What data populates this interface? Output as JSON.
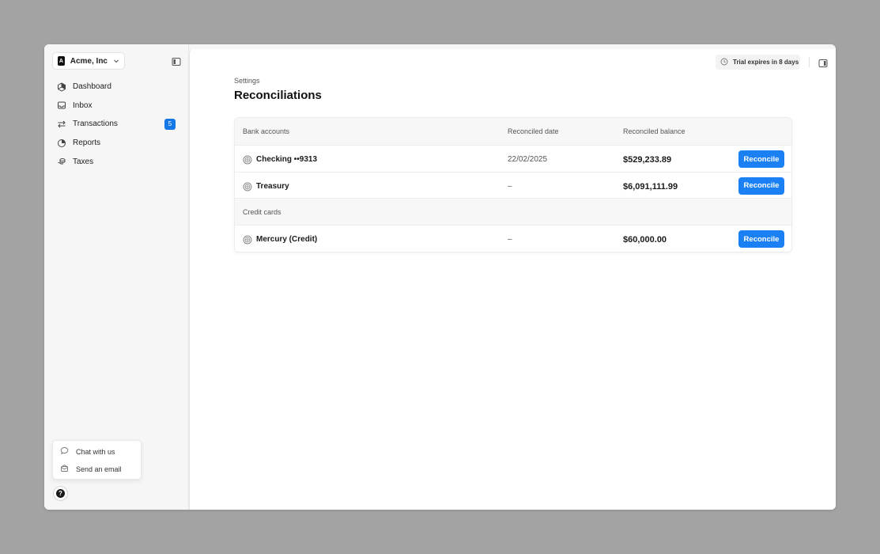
{
  "org": {
    "logo_letter": "A",
    "name": "Acme, Inc"
  },
  "sidebar": {
    "items": [
      {
        "label": "Dashboard",
        "icon": "dashboard-icon"
      },
      {
        "label": "Inbox",
        "icon": "inbox-icon"
      },
      {
        "label": "Transactions",
        "icon": "transactions-icon",
        "badge": "5"
      },
      {
        "label": "Reports",
        "icon": "reports-icon"
      },
      {
        "label": "Taxes",
        "icon": "taxes-icon"
      }
    ]
  },
  "help": {
    "menu": [
      {
        "label": "Chat with us",
        "icon": "chat-icon"
      },
      {
        "label": "Send an email",
        "icon": "email-icon"
      }
    ],
    "button_glyph": "?"
  },
  "header": {
    "trial_text": "Trial expires in 8 days"
  },
  "page": {
    "breadcrumb": "Settings",
    "title": "Reconciliations"
  },
  "table": {
    "columns": {
      "date": "Reconciled date",
      "balance": "Reconciled balance"
    },
    "groups": [
      {
        "title": "Bank accounts",
        "rows": [
          {
            "name": "Checking ••9313",
            "date": "22/02/2025",
            "balance": "$529,233.89",
            "action": "Reconcile"
          },
          {
            "name": "Treasury",
            "date": "–",
            "balance": "$6,091,111.99",
            "action": "Reconcile"
          }
        ]
      },
      {
        "title": "Credit cards",
        "rows": [
          {
            "name": "Mercury (Credit)",
            "date": "–",
            "balance": "$60,000.00",
            "action": "Reconcile"
          }
        ]
      }
    ]
  },
  "colors": {
    "accent": "#1b80f3",
    "badge": "#1677e6",
    "backdrop": "#a3a3a3"
  }
}
